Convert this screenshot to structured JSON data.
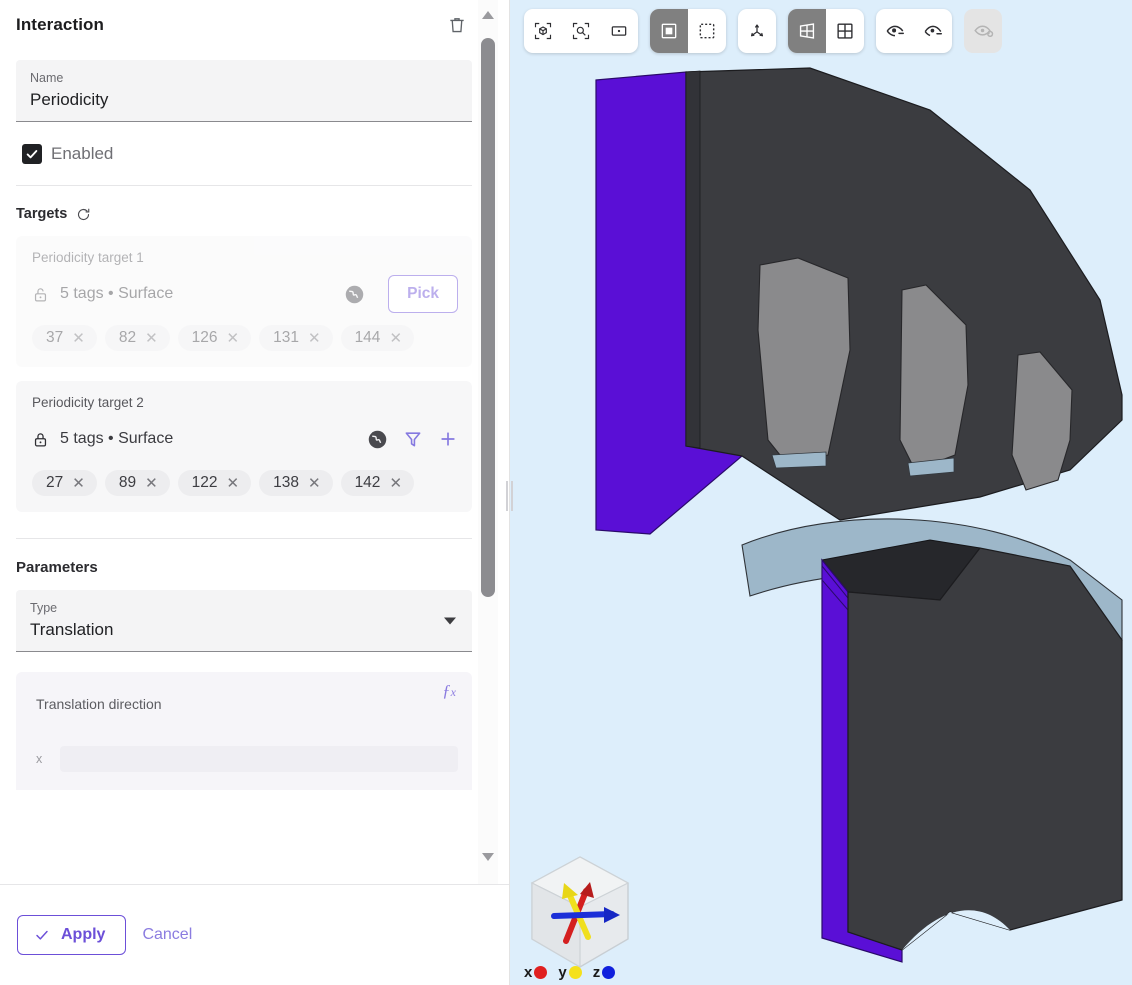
{
  "panel": {
    "title": "Interaction",
    "delete_icon": "trash-icon",
    "name_field": {
      "label": "Name",
      "value": "Periodicity"
    },
    "enabled": {
      "label": "Enabled",
      "checked": true
    },
    "targets": {
      "title": "Targets",
      "refresh_icon": "refresh-icon",
      "items": [
        {
          "name": "Periodicity target 1",
          "lock_icon": "lock-open-icon",
          "description": "5 tags • Surface",
          "globe_icon": "globe-icon",
          "pick_label": "Pick",
          "tags": [
            "37",
            "82",
            "126",
            "131",
            "144"
          ],
          "disabled": true
        },
        {
          "name": "Periodicity target 2",
          "lock_icon": "lock-closed-icon",
          "description": "5 tags • Surface",
          "globe_icon": "globe-icon",
          "filter_icon": "filter-icon",
          "add_icon": "plus-icon",
          "tags": [
            "27",
            "89",
            "122",
            "138",
            "142"
          ],
          "disabled": false
        }
      ]
    },
    "parameters": {
      "title": "Parameters",
      "type_field": {
        "label": "Type",
        "value": "Translation"
      },
      "expression": {
        "label": "Translation direction",
        "fx_icon": "fx-icon",
        "axis_label": "x",
        "value": ""
      }
    },
    "footer": {
      "apply_label": "Apply",
      "cancel_label": "Cancel"
    },
    "scrollbar": {
      "up_icon": "scroll-up-arrow",
      "down_icon": "scroll-down-arrow"
    }
  },
  "viewport": {
    "toolbar": {
      "groups": [
        {
          "buttons": [
            {
              "icon": "fit-to-object-icon",
              "active": false
            },
            {
              "icon": "zoom-to-selection-icon",
              "active": false
            },
            {
              "icon": "fit-to-window-icon",
              "active": false
            }
          ]
        },
        {
          "buttons": [
            {
              "icon": "select-box-icon",
              "active": true
            },
            {
              "icon": "select-rubberband-icon",
              "active": false
            }
          ]
        },
        {
          "buttons": [
            {
              "icon": "axes-triad-icon",
              "active": false
            }
          ]
        },
        {
          "buttons": [
            {
              "icon": "perspective-view-icon",
              "active": true
            },
            {
              "icon": "orthographic-view-icon",
              "active": false
            }
          ]
        },
        {
          "buttons": [
            {
              "icon": "hide-selected-icon",
              "active": false
            },
            {
              "icon": "show-only-selected-icon",
              "active": false
            }
          ]
        },
        {
          "buttons": [
            {
              "icon": "reset-visibility-icon",
              "active": false,
              "disabled": true
            }
          ]
        }
      ]
    },
    "nav_cube": {
      "label": "navigation-cube",
      "axes": [
        {
          "name": "x",
          "color": "#e02020"
        },
        {
          "name": "y",
          "color": "#f5e11b"
        },
        {
          "name": "z",
          "color": "#1020dd"
        }
      ]
    },
    "colors": {
      "background": "#ddeefb",
      "body": "#3b3c40",
      "selected_face": "#5a0fd6",
      "slot": "#8a8a8c",
      "band": "#9db7c9"
    }
  }
}
